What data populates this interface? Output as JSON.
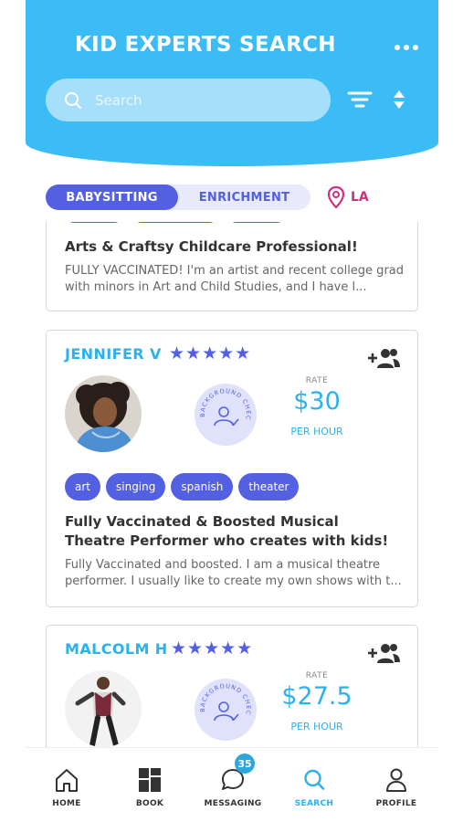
{
  "header": {
    "title": "KID EXPERTS SEARCH",
    "search_placeholder": "Search"
  },
  "tabs": [
    {
      "label": "BABYSITTING",
      "active": true
    },
    {
      "label": "ENRICHMENT",
      "active": false
    }
  ],
  "location": {
    "label": "LA"
  },
  "listings": [
    {
      "title": "Arts & Craftsy Childcare Professional!",
      "description": "FULLY VACCINATED! I'm an artist and recent college grad with minors in Art and Child Studies, and I have l..."
    },
    {
      "name": "JENNIFER V",
      "stars": "★★★★★",
      "rating": 5,
      "badge_text": "BACKGROUND CHECKED",
      "rate_label": "RATE",
      "rate": "$30",
      "rate_unit": "PER HOUR",
      "tags": [
        "art",
        "singing",
        "spanish",
        "theater"
      ],
      "title": "Fully Vaccinated & Boosted Musical Theatre Performer who creates with kids!",
      "description": "Fully Vaccinated and boosted. I am a musical theatre performer. I usually like to create my own shows with t..."
    },
    {
      "name": "MALCOLM H",
      "stars": "★★★★★",
      "rating": 5,
      "badge_text": "BACKGROUND CHECKED",
      "rate_label": "RATE",
      "rate": "$27.5",
      "rate_unit": "PER HOUR"
    }
  ],
  "nav": [
    {
      "label": "HOME",
      "icon": "home-icon"
    },
    {
      "label": "BOOK",
      "icon": "grid-icon"
    },
    {
      "label": "MESSAGING",
      "icon": "chat-icon",
      "badge": "35"
    },
    {
      "label": "SEARCH",
      "icon": "search-icon",
      "active": true
    },
    {
      "label": "PROFILE",
      "icon": "person-icon"
    }
  ],
  "colors": {
    "header": "#3bbcf4",
    "accent": "#5460e2",
    "link_blue": "#2bb2ee",
    "location_pink": "#d0307b"
  }
}
